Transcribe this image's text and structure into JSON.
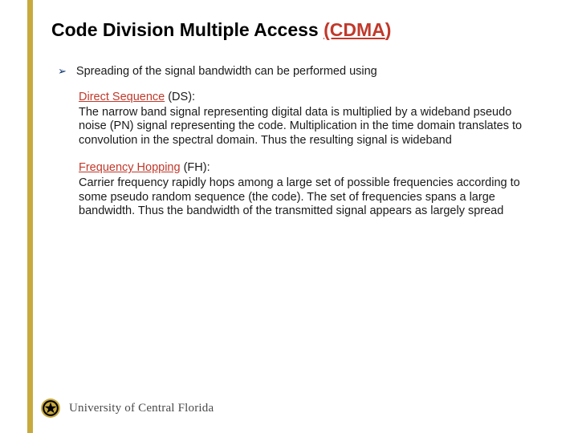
{
  "title": {
    "black": "Code Division Multiple Access ",
    "red_underlined": "(CDMA",
    "red_tail": ")"
  },
  "bullet": {
    "marker": "➢",
    "text": "Spreading of the signal bandwidth can be performed using"
  },
  "sections": [
    {
      "label_underlined": "Direct Sequence",
      "label_tail": " (DS):",
      "desc": "The narrow band signal representing digital data is multiplied by a wideband pseudo noise (PN) signal representing the code. Multiplication in the time domain translates to convolution in the spectral domain. Thus the resulting signal is wideband"
    },
    {
      "label_underlined": "Frequency Hopping",
      "label_tail": " (FH):",
      "desc": "Carrier frequency rapidly hops among a large set of possible frequencies according to some pseudo random sequence (the code). The set of frequencies spans a large bandwidth. Thus the bandwidth of the transmitted signal appears as largely spread"
    }
  ],
  "footer": {
    "university": "University of Central Florida"
  }
}
